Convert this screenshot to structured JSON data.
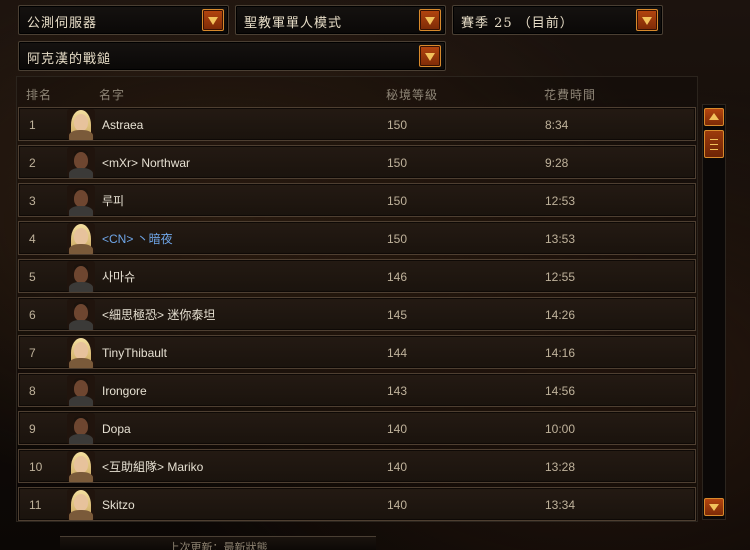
{
  "filters": {
    "server": "公測伺服器",
    "mode": "聖教軍單人模式",
    "season": "賽季 25 （目前）",
    "class": "阿克漢的戰鎚"
  },
  "columns": {
    "rank": "排名",
    "name": "名字",
    "level": "秘境等級",
    "time": "花費時間"
  },
  "rows": [
    {
      "rank": "1",
      "name": "Astraea",
      "level": "150",
      "time": "8:34"
    },
    {
      "rank": "2",
      "name": "<mXr> Northwar",
      "level": "150",
      "time": "9:28"
    },
    {
      "rank": "3",
      "name": "루피",
      "level": "150",
      "time": "12:53"
    },
    {
      "rank": "4",
      "name": "<CN> 丶暗夜",
      "level": "150",
      "time": "13:53"
    },
    {
      "rank": "5",
      "name": "사마슈",
      "level": "146",
      "time": "12:55"
    },
    {
      "rank": "6",
      "name": "<細思極恐> 迷你泰坦",
      "level": "145",
      "time": "14:26"
    },
    {
      "rank": "7",
      "name": "TinyThibault",
      "level": "144",
      "time": "14:16"
    },
    {
      "rank": "8",
      "name": "Irongore",
      "level": "143",
      "time": "14:56"
    },
    {
      "rank": "9",
      "name": "Dopa",
      "level": "140",
      "time": "10:00"
    },
    {
      "rank": "10",
      "name": "<互助組隊> Mariko",
      "level": "140",
      "time": "13:28"
    },
    {
      "rank": "11",
      "name": "Skitzo",
      "level": "140",
      "time": "13:34"
    }
  ],
  "footer": {
    "text": "上次更新：最新狀態"
  },
  "colors": {
    "accent_orange": "#b4450f",
    "highlight_name": "#6fa6e8"
  }
}
